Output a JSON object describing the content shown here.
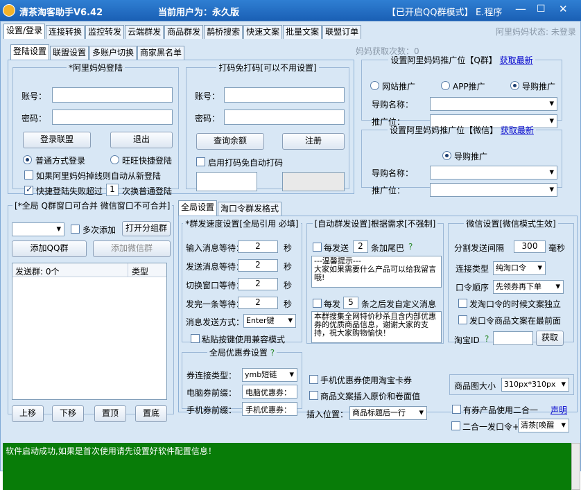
{
  "window": {
    "title": "清茶淘客助手V6.42",
    "current_user": "当前用户为：永久版",
    "qq_mode": "【已开启QQ群模式】",
    "menu": "E.程序"
  },
  "main_tabs": [
    "设置/登录",
    "连接转换",
    "监控转发",
    "云端群发",
    "商品群发",
    "鹊桥搜索",
    "快速文案",
    "批量文案",
    "联盟订单"
  ],
  "alimama_status": "阿里妈妈状态: 未登录",
  "sub_tabs": [
    "登陆设置",
    "联盟设置",
    "多账户切换",
    "商家黑名单"
  ],
  "fetch_count": "妈妈获取次数：0",
  "alimama_login": {
    "legend": "*阿里妈妈登陆",
    "account_label": "账号：",
    "password_label": "密码：",
    "login_btn": "登录联盟",
    "logout_btn": "退出",
    "radio_normal": "普通方式登录",
    "radio_wangwang": "旺旺快捷登陆",
    "auto_relogin": "如果阿里妈妈掉线则自动从新登陆",
    "fast_fail_pre": "快捷登陆失败超过",
    "fast_fail_num": "1",
    "fast_fail_post": "次换普通登陆"
  },
  "dama": {
    "legend": "打码免打码[可以不用设置]",
    "account_label": "账号：",
    "password_label": "密码：",
    "balance_btn": "查询余额",
    "register_btn": "注册",
    "auto_dama": "启用打码免自动打码"
  },
  "promo_qq": {
    "legend": "设置阿里妈妈推广位【Q群】",
    "refresh": "获取最新",
    "radio_site": "网站推广",
    "radio_app": "APP推广",
    "radio_guide": "导购推广",
    "guide_name_label": "导购名称：",
    "position_label": "推广位："
  },
  "promo_wx": {
    "legend": "设置阿里妈妈推广位【微信】",
    "refresh": "获取最新",
    "radio_guide": "导购推广",
    "guide_name_label": "导购名称：",
    "position_label": "推广位："
  },
  "group_panel": {
    "legend": "[*全局 Q群窗口可合并 微信窗口不可合并]",
    "multi_add": "多次添加",
    "open_group_tree": "打开分组群",
    "add_qq": "添加QQ群",
    "add_wechat": "添加微信群",
    "col_group": "发送群: 0个",
    "col_type": "类型",
    "up": "上移",
    "down": "下移",
    "top": "置顶",
    "bottom": "置底"
  },
  "settings_tabs": [
    "全局设置",
    "淘口令群发格式"
  ],
  "speed": {
    "legend": "*群发速度设置[全局引用 必填]",
    "rows": [
      {
        "label": "输入消息等待：",
        "value": "2",
        "unit": "秒"
      },
      {
        "label": "发送消息等待：",
        "value": "2",
        "unit": "秒"
      },
      {
        "label": "切换窗口等待：",
        "value": "2",
        "unit": "秒"
      },
      {
        "label": "发完一条等待：",
        "value": "2",
        "unit": "秒"
      }
    ],
    "send_mode_label": "消息发送方式：",
    "send_mode_value": "Enter键",
    "paste_compat": "粘贴按键使用兼容模式"
  },
  "auto_send": {
    "legend": "[自动群发设置]根据需求[不强制]",
    "every_pre": "每发送",
    "every_num": "2",
    "every_post": "条加尾巴",
    "help": "?",
    "tail_text": "---温馨提示---\n大家如果需要什么产品可以给我留言哦!",
    "custom_pre": "每发",
    "custom_num": "5",
    "custom_post": "条之后发自定义消息",
    "custom_text": "本群搜集全网特价秒杀且含内部优惠券的优质商品信息，谢谢大家的支持，祝大家购物愉快！"
  },
  "wechat": {
    "legend": "微信设置[微信模式生效]",
    "interval_label": "分割发送间隔",
    "interval_value": "300",
    "interval_unit": "毫秒",
    "link_type_label": "连接类型",
    "link_type_value": "纯淘口令",
    "order_label": "口令顺序",
    "order_value": "先领券再下单",
    "cb_time_text": "发淘口令的时候文案独立",
    "cb_text_first": "发口令商品文案在最前面",
    "taobao_id_label": "淘宝ID",
    "help": "?",
    "fetch_btn": "获取"
  },
  "coupon": {
    "legend": "全局优惠券设置",
    "help": "?",
    "type_label": "券连接类型：",
    "type_value": "ymb短链",
    "pc_prefix_label": "电脑券前缀：",
    "pc_prefix_value": "电脑优惠券：",
    "mobile_prefix_label": "手机券前缀：",
    "mobile_prefix_value": "手机优惠券："
  },
  "misc": {
    "cb_mobile_card": "手机优惠券使用淘宝卡券",
    "cb_price_insert": "商品文案插入原价和卷面值",
    "insert_pos_label": "插入位置：",
    "insert_pos_value": "商品标题后一行",
    "img_size_label": "商品图大小",
    "img_size_value": "310px*310px",
    "cb_two_in_one": "有券产品使用二合一",
    "statement": "声明",
    "cb_two_in_one_send": "二合一发口令+",
    "two_in_one_value": "清茶[唤醒"
  },
  "status": "软件启动成功,如果是首次使用请先设置好软件配置信息！"
}
